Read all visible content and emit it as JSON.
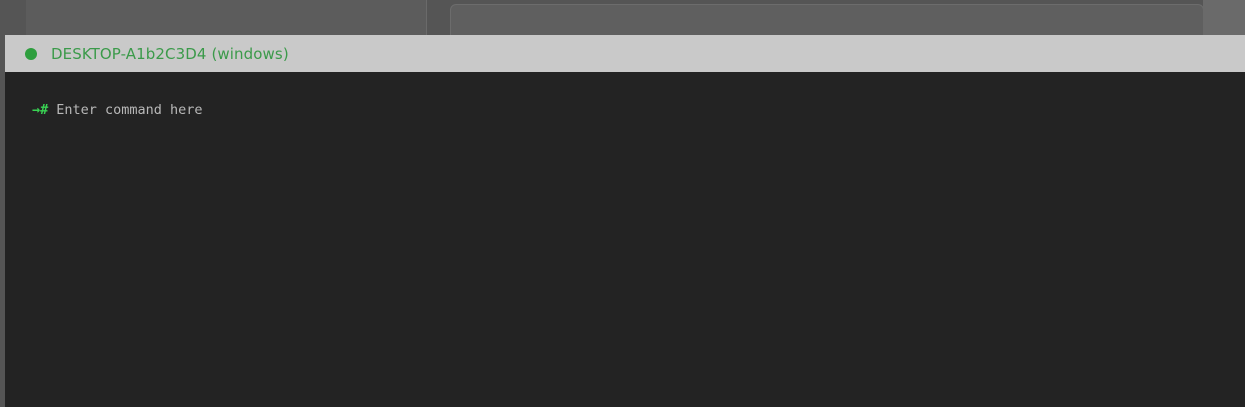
{
  "window": {
    "title": "DESKTOP-A1b2C3D4 (windows)",
    "status_color": "#2e9e3e"
  },
  "terminal": {
    "prompt": "→#",
    "input_value": "",
    "placeholder": "Enter command here"
  }
}
